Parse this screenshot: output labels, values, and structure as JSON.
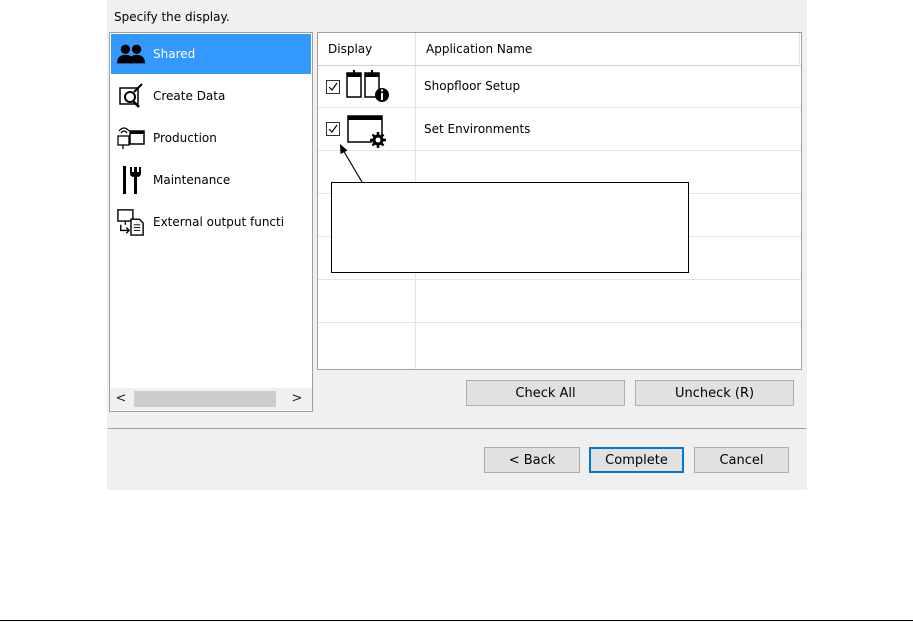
{
  "instruction": "Specify the display.",
  "categories": [
    {
      "label": "Shared",
      "icon": "users-icon",
      "selected": true
    },
    {
      "label": "Create Data",
      "icon": "create-data-icon",
      "selected": false
    },
    {
      "label": "Production",
      "icon": "production-icon",
      "selected": false
    },
    {
      "label": "Maintenance",
      "icon": "maintenance-tools-icon",
      "selected": false
    },
    {
      "label": "External output functi",
      "icon": "external-output-icon",
      "selected": false
    }
  ],
  "grid": {
    "col_display": "Display",
    "col_app_name": "Application Name",
    "rows": [
      {
        "name": "Shopfloor Setup",
        "checked": true,
        "icon": "shopfloor-setup-icon"
      },
      {
        "name": "Set Environments",
        "checked": true,
        "icon": "set-environments-icon"
      }
    ]
  },
  "buttons": {
    "check_all": "Check All",
    "uncheck": "Uncheck (R)",
    "back": "< Back",
    "complete": "Complete",
    "cancel": "Cancel"
  },
  "scrollbar": {
    "left": "<",
    "right": ">"
  },
  "colors": {
    "selection": "#3399ff",
    "dialog_bg": "#f0f0f0",
    "default_button_border": "#0078d7"
  }
}
